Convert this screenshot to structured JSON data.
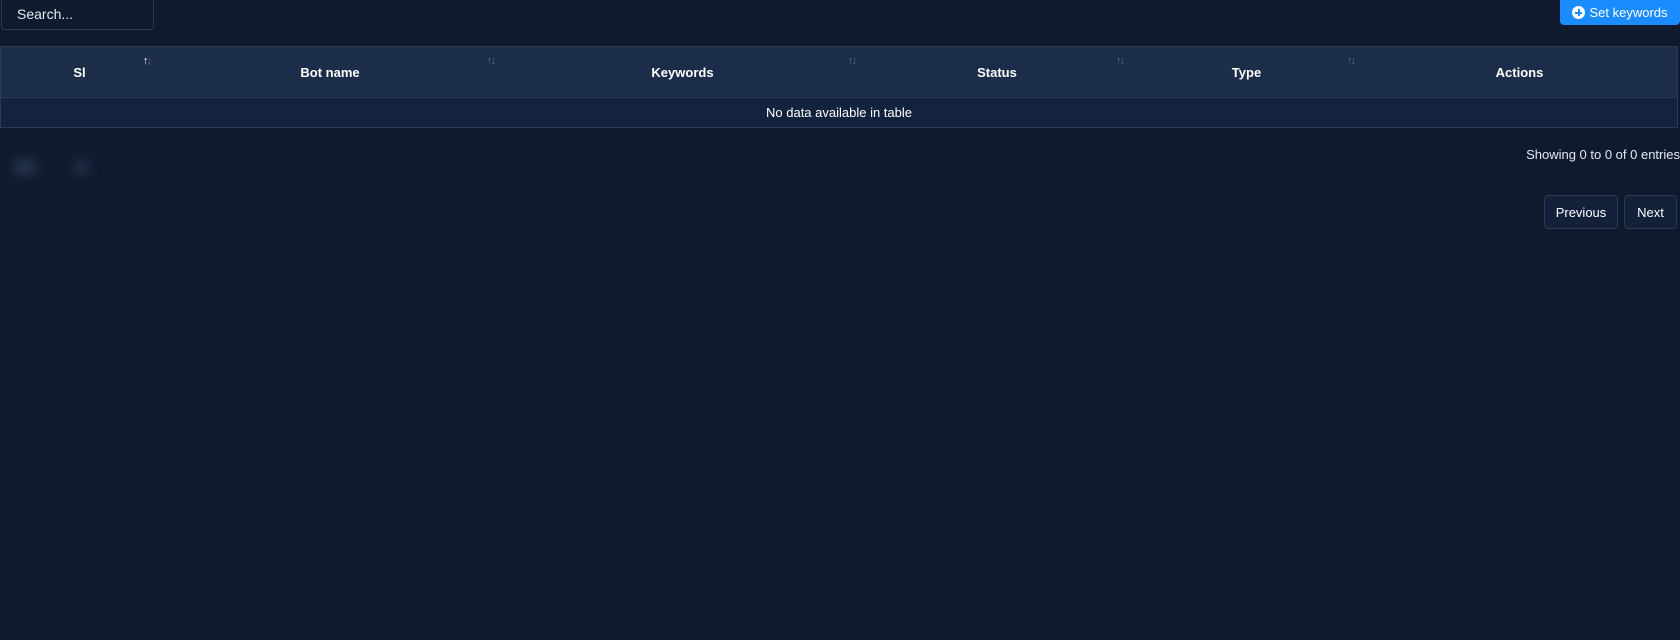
{
  "search": {
    "placeholder": "Search..."
  },
  "toolbar": {
    "set_keywords_label": "Set keywords",
    "set_keywords_icon": "plus-circle-icon",
    "accent_color": "#1a8cff"
  },
  "table": {
    "columns": [
      "Sl",
      "Bot name",
      "Keywords",
      "Status",
      "Type",
      "Actions"
    ],
    "sort_icon": "⇅",
    "empty_message": "No data available in table"
  },
  "footer": {
    "info": "Showing 0 to 0 of 0 entries",
    "previous_label": "Previous",
    "next_label": "Next"
  },
  "colors": {
    "background": "#0f1a2e",
    "header_bg": "#1c2d4a",
    "row_bg": "#13223d",
    "border": "#2c3b55"
  }
}
